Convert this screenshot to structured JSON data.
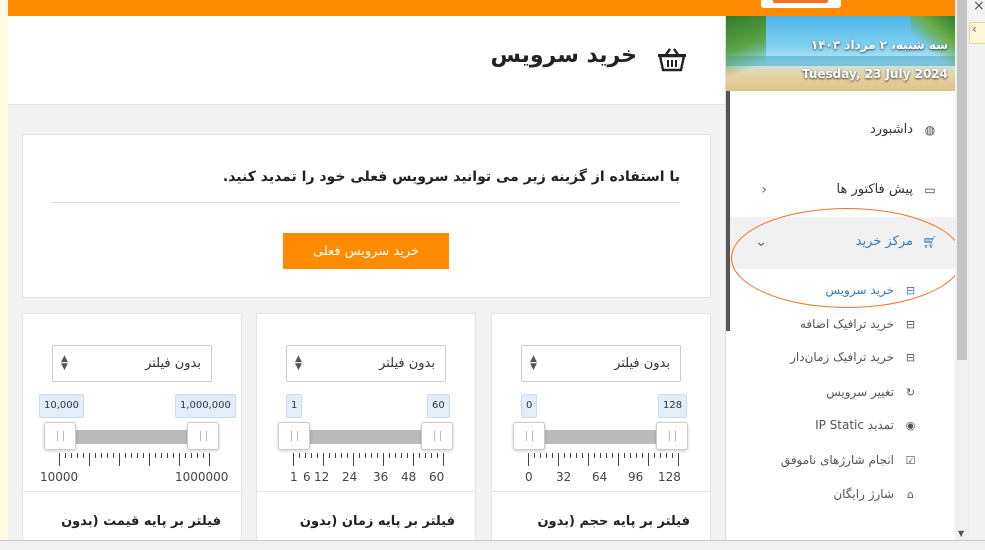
{
  "sidebar": {
    "date_fa": "سه شنبه، ۲ مرداد ۱۴۰۳",
    "date_en": "Tuesday, 23 July 2024",
    "items": [
      {
        "label": "داشبورد",
        "icon": "dashboard-icon"
      },
      {
        "label": "پیش فاکتور ها",
        "icon": "credit-card-icon"
      },
      {
        "label": "مرکز خرید",
        "icon": "cart-icon"
      }
    ],
    "subitems": [
      {
        "label": "خرید سرویس",
        "icon": "basket-icon",
        "active": true
      },
      {
        "label": "خرید ترافیک اضافه",
        "icon": "basket-icon"
      },
      {
        "label": "خرید ترافیک زمان‌دار",
        "icon": "basket-icon"
      },
      {
        "label": "تغییر سرویس",
        "icon": "refresh-icon"
      },
      {
        "label": "تمدید IP Static",
        "icon": "globe-icon"
      },
      {
        "label": "انجام شارژهای ناموفق",
        "icon": "check-square-icon"
      },
      {
        "label": "شارژ رایگان",
        "icon": "gift-icon"
      }
    ]
  },
  "header": {
    "title": "خرید سرویس",
    "icon": "basket-icon"
  },
  "renew": {
    "message": "با استفاده از گزینه زیر می توانید سرویس فعلی خود را تمدید کنید.",
    "button": "خرید سرویس فعلی"
  },
  "filters": [
    {
      "title": "فیلتر بر پایه حجم (بدون",
      "select": "بدون فیلتر",
      "min_tag": "0",
      "max_tag": "128",
      "range": [
        0,
        128
      ],
      "selected": [
        0,
        128
      ],
      "tick_labels": [
        "0",
        "32",
        "64",
        "96",
        "128"
      ]
    },
    {
      "title": "فیلتر بر پایه زمان (بدون",
      "select": "بدون فیلتر",
      "min_tag": "1",
      "max_tag": "60",
      "range": [
        1,
        60
      ],
      "selected": [
        1,
        60
      ],
      "tick_labels": [
        "1",
        "6",
        "12",
        "24",
        "36",
        "48",
        "60"
      ]
    },
    {
      "title": "فیلتر بر پایه قیمت (بدون",
      "select": "بدون فیلتر",
      "min_tag": "10,000",
      "max_tag": "1,000,000",
      "range": [
        10000,
        1000000
      ],
      "selected": [
        10000,
        1000000
      ],
      "tick_labels": [
        "10000",
        "1000000"
      ]
    }
  ],
  "colors": {
    "accent": "#ff8c00",
    "link": "#337ab7",
    "highlight_circle": "#f37022"
  }
}
